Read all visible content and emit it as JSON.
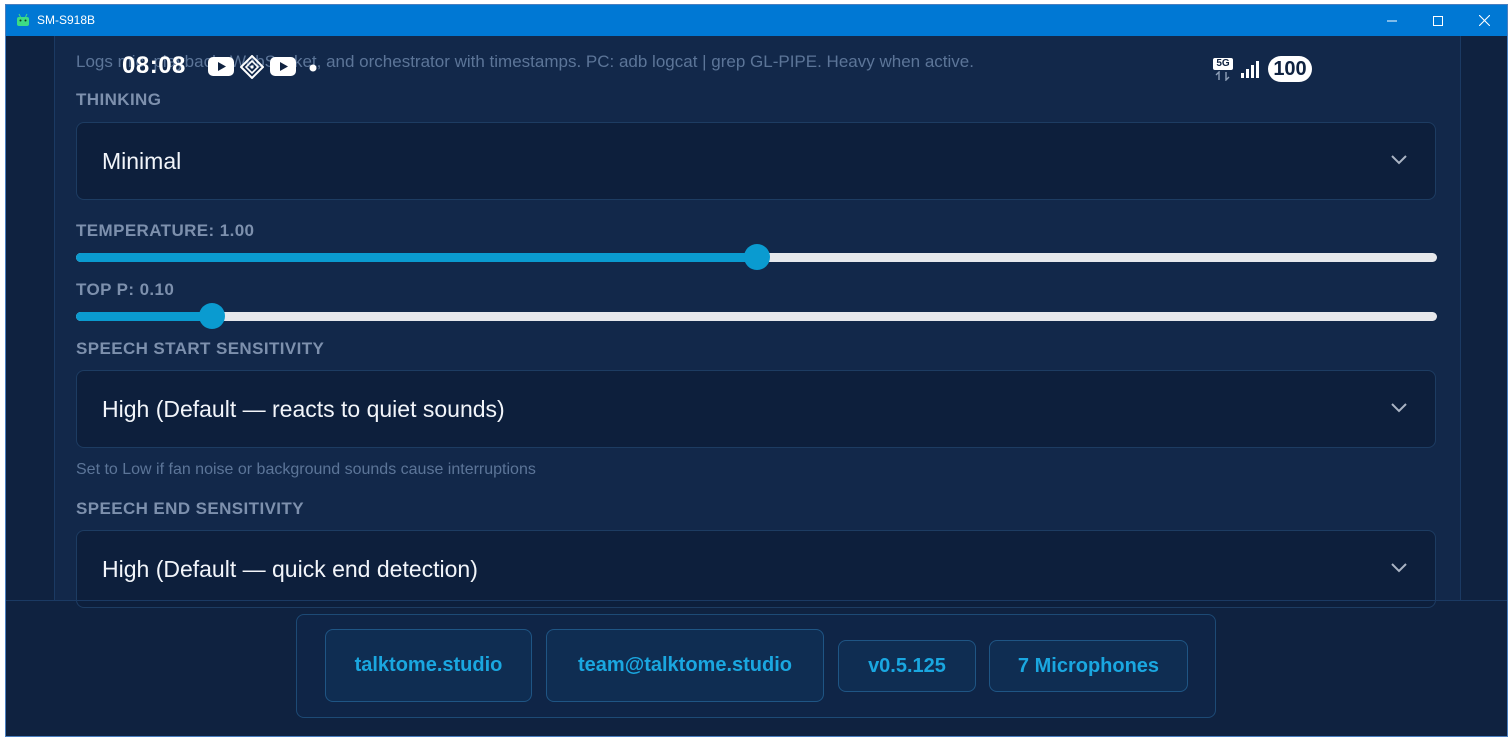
{
  "window": {
    "title": "SM-S918B",
    "controls": {
      "minimize": "minimize",
      "maximize": "maximize",
      "close": "close"
    }
  },
  "status_bar": {
    "time": "08:08",
    "network": "5G",
    "battery": "100"
  },
  "settings": {
    "logs_help_text": "Logs mic, playback, WebSocket, and orchestrator with timestamps. PC: adb logcat | grep GL-PIPE. Heavy when active.",
    "thinking": {
      "label": "THINKING",
      "value": "Minimal"
    },
    "temperature": {
      "label": "TEMPERATURE: 1.00",
      "value": 1.0,
      "min": 0,
      "max": 2
    },
    "top_p": {
      "label": "TOP P: 0.10",
      "value": 0.1,
      "min": 0,
      "max": 1
    },
    "speech_start": {
      "label": "SPEECH START SENSITIVITY",
      "value": "High (Default — reacts to quiet sounds)",
      "hint": "Set to Low if fan noise or background sounds cause interruptions"
    },
    "speech_end": {
      "label": "SPEECH END SENSITIVITY",
      "value": "High (Default — quick end detection)"
    }
  },
  "footer": {
    "website": "talktome.studio",
    "email": "team@talktome.studio",
    "version": "v0.5.125",
    "microphones": "7 Microphones"
  },
  "colors": {
    "titlebar": "#0078d4",
    "background": "#0f2240",
    "panel": "#12284a",
    "accent": "#0a9bd0",
    "label": "#7d90ad",
    "muted_text": "#5c7598"
  },
  "icons": [
    "android-app-icon",
    "youtube-icon",
    "diamond-app-icon",
    "youtube-icon",
    "dot-icon",
    "5g-icon",
    "signal-icon",
    "battery-icon",
    "chevron-down-icon"
  ]
}
